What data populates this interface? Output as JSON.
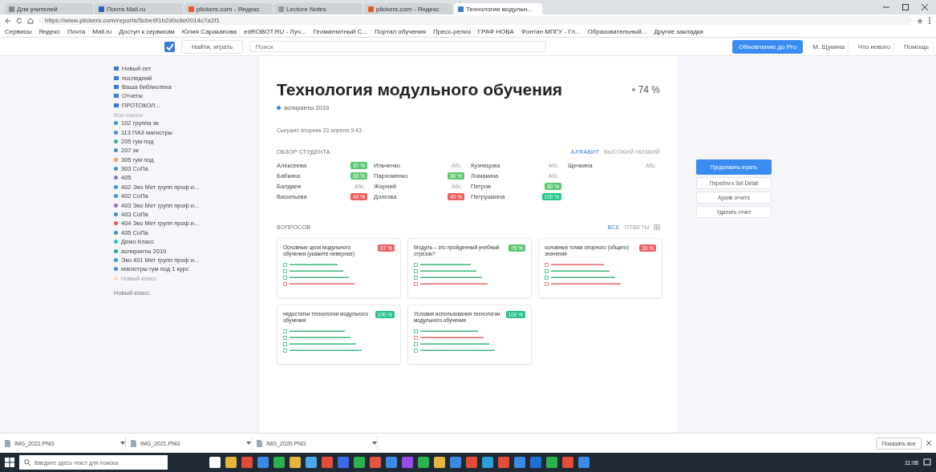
{
  "browser": {
    "tabs": [
      {
        "label": "Для учителей",
        "selected": false
      },
      {
        "label": "Почта Mail.ru",
        "selected": false
      },
      {
        "label": "plickers.com - Яндекс",
        "selected": false
      },
      {
        "label": "Lecture Notes",
        "selected": false
      },
      {
        "label": "plickers.com - Яндекс",
        "selected": false
      },
      {
        "label": "Технология модульн...",
        "selected": true
      }
    ],
    "address": "https://www.plickers.com/reports/5cbe9f1b2d0c8e0014c7a2f1",
    "bookmarks": [
      "Сервисы",
      "Яндекс",
      "Почта",
      "Mail.ru",
      "Доступ к сервисам",
      "Юлия Саракапова",
      "edROBOT.RU - Луч...",
      "Геомагнитный С...",
      "Портал обучения",
      "Пресс-релиз",
      "ГРАФ НОВА",
      "Фонтан МПГУ - Гл...",
      "Образовательный...",
      "Другие закладки"
    ]
  },
  "app_header": {
    "play_button": "Найти, играть",
    "search": {
      "placeholder": "Поиск"
    },
    "upgrade_button": "Обновление до Pro",
    "user": "М. Щукина",
    "links": [
      "Что нового",
      "Помощь"
    ]
  },
  "sidebar": {
    "top_items": [
      "Новый сет",
      "последний",
      "Ваша библиотека",
      "Отчеты",
      "ПРОТОКОЛ..."
    ],
    "section": "Мои классы",
    "classes": [
      {
        "label": "102 группа эк",
        "color": "#3f8fd6",
        "archived": false
      },
      {
        "label": "113 ПАЗ магистры",
        "color": "#3f8fd6",
        "archived": false
      },
      {
        "label": "205 гум под",
        "color": "#3cb28a",
        "archived": false
      },
      {
        "label": "207 эк",
        "color": "#3f8fd6",
        "archived": false
      },
      {
        "label": "305 гум под",
        "color": "#f0a24a",
        "archived": false
      },
      {
        "label": "303 СоПа",
        "color": "#3f8fd6",
        "archived": false
      },
      {
        "label": "405",
        "color": "#9a6fd0",
        "archived": false
      },
      {
        "label": "402 Эко Мет групп проф и...",
        "color": "#3f8fd6",
        "archived": false
      },
      {
        "label": "402 СоПа",
        "color": "#3f8fd6",
        "archived": false
      },
      {
        "label": "403 Эко Мет групп проф и...",
        "color": "#9a6fd0",
        "archived": false
      },
      {
        "label": "403 СоПа",
        "color": "#3f8fd6",
        "archived": false
      },
      {
        "label": "404 Эко Мет групп проф и...",
        "color": "#e8505b",
        "archived": false
      },
      {
        "label": "405 СоПа",
        "color": "#3f8fd6",
        "archived": false
      },
      {
        "label": "Демо Класс",
        "color": "#2ec4b6",
        "archived": false
      },
      {
        "label": "аспиранты 2019",
        "color": "#1fa8a0",
        "archived": false
      },
      {
        "label": "Эко 401 Мет групп проф и...",
        "color": "#2a9fd6",
        "archived": false
      },
      {
        "label": "магистры гум под 1 курс",
        "color": "#3f8fd6",
        "archived": false
      },
      {
        "label": "Новый класс",
        "color": "#f8dcb6",
        "archived": true
      }
    ],
    "new_class": "Новый класс"
  },
  "report": {
    "title": "Технология модульного обучения",
    "score": "74 %",
    "class": {
      "label": "аспиранты 2019",
      "color": "#3f8fd6"
    },
    "played": "Сыграно вторник 23 апреля 9:43",
    "students_heading": "ОБЗОР СТУДЕНТА",
    "sort": [
      {
        "label": "АЛФАВИТ",
        "selected": true
      },
      {
        "label": "ВЫСОКИЙ НИЗКИЙ",
        "selected": false
      }
    ],
    "student_columns": [
      [
        {
          "name": "Алексеева",
          "score": "67 %",
          "color": "#5cc870"
        },
        {
          "name": "Бабкина",
          "score": "80 %",
          "color": "#5cc870"
        },
        {
          "name": "Балдаев",
          "score": "Абс."
        },
        {
          "name": "Васильева",
          "score": "40 %",
          "color": "#ee5f5f"
        }
      ],
      [
        {
          "name": "Ильченко",
          "score": "Абс."
        },
        {
          "name": "Пархоменко",
          "score": "80 %",
          "color": "#5cc870"
        },
        {
          "name": "Жарний",
          "score": "Абс."
        },
        {
          "name": "Долгова",
          "score": "40 %",
          "color": "#ee5f5f"
        }
      ],
      [
        {
          "name": "Кузнецова",
          "score": "Абс."
        },
        {
          "name": "Ломакина",
          "score": "Абс."
        },
        {
          "name": "Петров",
          "score": "80 %",
          "color": "#5cc870"
        },
        {
          "name": "Петрушкина",
          "score": "100 %",
          "color": "#22c48a"
        }
      ],
      [
        {
          "name": "Щечкина",
          "score": "Абс."
        }
      ]
    ],
    "questions_heading": "ВОПРОСОВ",
    "question_filters": [
      {
        "label": "ВСЕ",
        "selected": true
      },
      {
        "label": "ОТВЕТЫ",
        "selected": false
      }
    ],
    "questions": [
      {
        "text": "Основные цели модульного обучения (укажите неверное)",
        "score": "67 %",
        "color": "#ee5f5f",
        "answers": [
          {
            "correct": true
          },
          {
            "correct": true
          },
          {
            "correct": true
          },
          {
            "correct": false
          }
        ]
      },
      {
        "text": "Модуль – это пройденный учебный отрезок?",
        "score": "75 %",
        "color": "#5cc870",
        "answers": [
          {
            "correct": true
          },
          {
            "correct": true
          },
          {
            "correct": true
          },
          {
            "correct": false
          }
        ]
      },
      {
        "text": "основные точки опорного (общего) значения",
        "score": "33 %",
        "color": "#ee5f5f",
        "answers": [
          {
            "correct": false
          },
          {
            "correct": true
          },
          {
            "correct": true
          },
          {
            "correct": false
          }
        ]
      },
      {
        "text": "недостатки технологии модульного обучения",
        "score": "100 %",
        "color": "#22c48a",
        "answers": [
          {
            "correct": true
          },
          {
            "correct": true
          },
          {
            "correct": true
          },
          {
            "correct": true
          }
        ]
      },
      {
        "text": "Условия использования технологии модульного обучения",
        "score": "100 %",
        "color": "#22c48a",
        "answers": [
          {
            "correct": true
          },
          {
            "correct": false
          },
          {
            "correct": true
          },
          {
            "correct": true
          }
        ]
      }
    ]
  },
  "actions": [
    {
      "label": "Продолжить играть",
      "primary": true
    },
    {
      "label": "Перейти к Set Detail",
      "primary": false
    },
    {
      "label": "Архив отчета",
      "primary": false
    },
    {
      "label": "Удалить отчет",
      "primary": false
    }
  ],
  "downloads": {
    "files": [
      "IMG_2022.PNG",
      "IMG_2021.PNG",
      "IMG_2020.PNG"
    ],
    "show_all": "Показать все"
  },
  "taskbar": {
    "search": {
      "placeholder": "Введите здесь текст для поиска"
    },
    "time": "11:08"
  }
}
